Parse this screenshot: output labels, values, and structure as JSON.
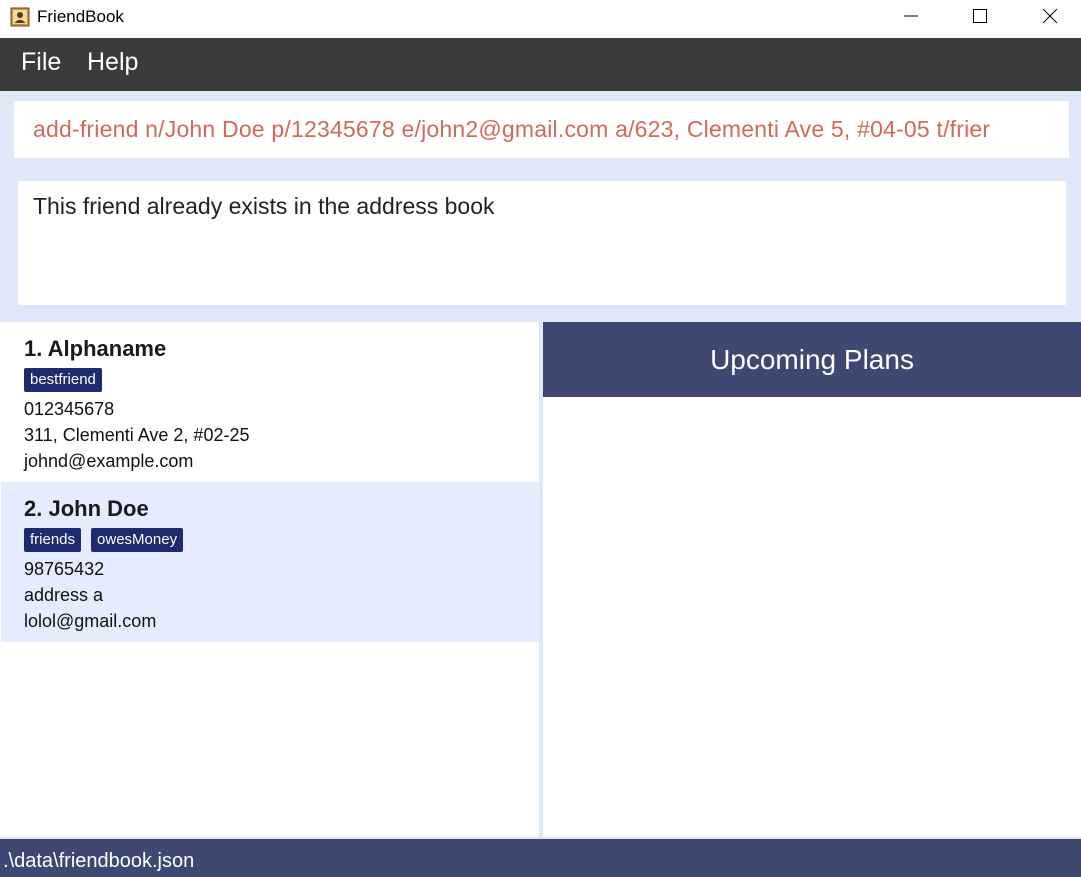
{
  "window": {
    "title": "FriendBook",
    "icons": {
      "app": "address-book-icon",
      "minimize": "minimize-icon",
      "maximize": "maximize-icon",
      "close": "close-icon"
    }
  },
  "menu": {
    "file": "File",
    "help": "Help"
  },
  "command": {
    "value": "add-friend n/John Doe p/12345678 e/john2@gmail.com a/623, Clementi Ave 5, #04-05 t/frier"
  },
  "result": {
    "text": "This friend already exists in the address book"
  },
  "friends": [
    {
      "name": "1.  Alphaname",
      "tags": [
        "bestfriend"
      ],
      "phone": "012345678",
      "address": "311, Clementi Ave 2, #02-25",
      "email": "johnd@example.com"
    },
    {
      "name": "2.  John Doe",
      "tags": [
        "friends",
        "owesMoney"
      ],
      "phone": "98765432",
      "address": "address a",
      "email": "lolol@gmail.com"
    }
  ],
  "plans": {
    "title": "Upcoming Plans"
  },
  "status": {
    "path": ".\\data\\friendbook.json"
  },
  "colors": {
    "menubar": "#3b3b3b",
    "accent": "#3e4870",
    "tag": "#1e2b6e",
    "command_error_text": "#d06a5a",
    "selected_card": "#e4ecfd",
    "background": "#dfe8f8"
  }
}
